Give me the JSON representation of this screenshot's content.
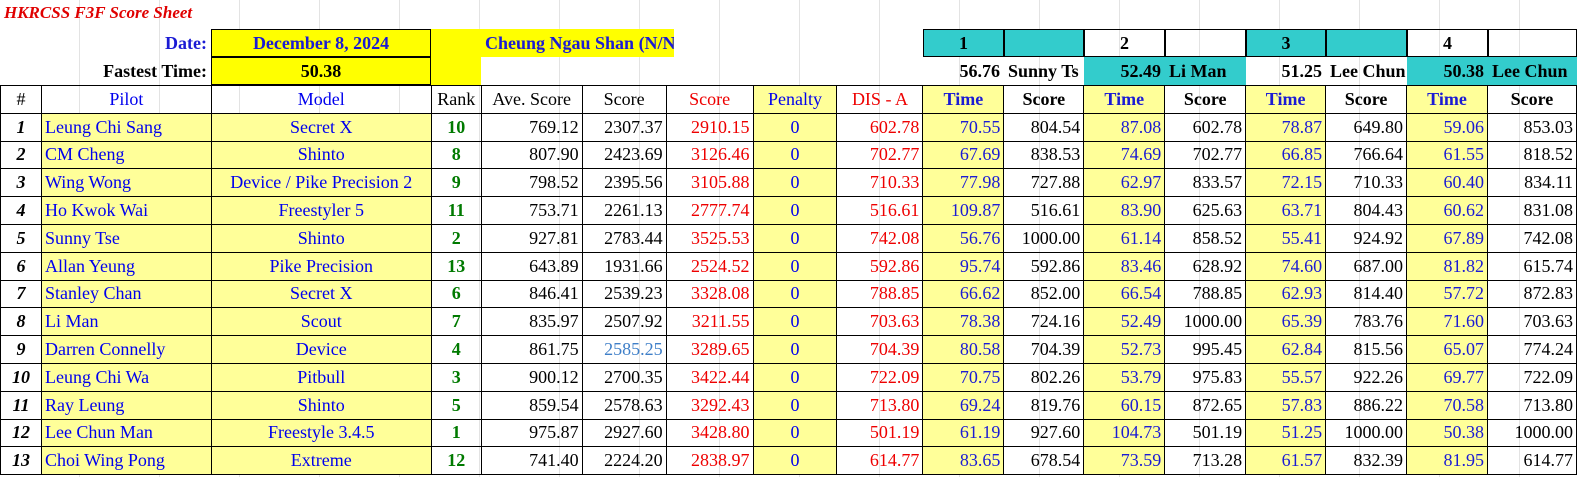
{
  "sheet": {
    "title": "HKRCSS F3F Score Sheet",
    "date_label": "Date:",
    "date_value": "December 8, 2024",
    "fastest_label": "Fastest Time:",
    "fastest_value": "50.38",
    "location": "Cheung Ngau Shan (N/NE)"
  },
  "rounds": [
    {
      "number": "1",
      "best_time": "56.76",
      "best_pilot": "Sunny Ts"
    },
    {
      "number": "2",
      "best_time": "52.49",
      "best_pilot": "Li Man"
    },
    {
      "number": "3",
      "best_time": "51.25",
      "best_pilot": "Lee Chun"
    },
    {
      "number": "4",
      "best_time": "50.38",
      "best_pilot": "Lee Chun"
    }
  ],
  "columns": {
    "index": "#",
    "pilot": "Pilot",
    "model": "Model",
    "rank": "Rank",
    "ave_score": "Ave. Score",
    "score": "Score",
    "score_total": "Score",
    "penalty": "Penalty",
    "dis": "DIS - A",
    "time": "Time",
    "round_score": "Score"
  },
  "rows": [
    {
      "idx": "1",
      "pilot": "Leung Chi Sang",
      "model": "Secret X",
      "rank": "10",
      "ave": "769.12",
      "score": "2307.37",
      "total": "2910.15",
      "penalty": "0",
      "dis": "602.78",
      "r": [
        [
          "70.55",
          "804.54"
        ],
        [
          "87.08",
          "602.78"
        ],
        [
          "78.87",
          "649.80"
        ],
        [
          "59.06",
          "853.03"
        ]
      ]
    },
    {
      "idx": "2",
      "pilot": "CM Cheng",
      "model": "Shinto",
      "rank": "8",
      "ave": "807.90",
      "score": "2423.69",
      "total": "3126.46",
      "penalty": "0",
      "dis": "702.77",
      "r": [
        [
          "67.69",
          "838.53"
        ],
        [
          "74.69",
          "702.77"
        ],
        [
          "66.85",
          "766.64"
        ],
        [
          "61.55",
          "818.52"
        ]
      ]
    },
    {
      "idx": "3",
      "pilot": "Wing Wong",
      "model": "Device / Pike Precision 2",
      "rank": "9",
      "ave": "798.52",
      "score": "2395.56",
      "total": "3105.88",
      "penalty": "0",
      "dis": "710.33",
      "r": [
        [
          "77.98",
          "727.88"
        ],
        [
          "62.97",
          "833.57"
        ],
        [
          "72.15",
          "710.33"
        ],
        [
          "60.40",
          "834.11"
        ]
      ]
    },
    {
      "idx": "4",
      "pilot": "Ho Kwok Wai",
      "model": "Freestyler 5",
      "rank": "11",
      "ave": "753.71",
      "score": "2261.13",
      "total": "2777.74",
      "penalty": "0",
      "dis": "516.61",
      "r": [
        [
          "109.87",
          "516.61"
        ],
        [
          "83.90",
          "625.63"
        ],
        [
          "63.71",
          "804.43"
        ],
        [
          "60.62",
          "831.08"
        ]
      ]
    },
    {
      "idx": "5",
      "pilot": "Sunny Tse",
      "model": "Shinto",
      "rank": "2",
      "ave": "927.81",
      "score": "2783.44",
      "total": "3525.53",
      "penalty": "0",
      "dis": "742.08",
      "r": [
        [
          "56.76",
          "1000.00"
        ],
        [
          "61.14",
          "858.52"
        ],
        [
          "55.41",
          "924.92"
        ],
        [
          "67.89",
          "742.08"
        ]
      ]
    },
    {
      "idx": "6",
      "pilot": "Allan Yeung",
      "model": "Pike Precision",
      "rank": "13",
      "ave": "643.89",
      "score": "1931.66",
      "total": "2524.52",
      "penalty": "0",
      "dis": "592.86",
      "r": [
        [
          "95.74",
          "592.86"
        ],
        [
          "83.46",
          "628.92"
        ],
        [
          "74.60",
          "687.00"
        ],
        [
          "81.82",
          "615.74"
        ]
      ]
    },
    {
      "idx": "7",
      "pilot": "Stanley Chan",
      "model": "Secret X",
      "rank": "6",
      "ave": "846.41",
      "score": "2539.23",
      "total": "3328.08",
      "penalty": "0",
      "dis": "788.85",
      "r": [
        [
          "66.62",
          "852.00"
        ],
        [
          "66.54",
          "788.85"
        ],
        [
          "62.93",
          "814.40"
        ],
        [
          "57.72",
          "872.83"
        ]
      ]
    },
    {
      "idx": "8",
      "pilot": "Li Man",
      "model": "Scout",
      "rank": "7",
      "ave": "835.97",
      "score": "2507.92",
      "total": "3211.55",
      "penalty": "0",
      "dis": "703.63",
      "r": [
        [
          "78.38",
          "724.16"
        ],
        [
          "52.49",
          "1000.00"
        ],
        [
          "65.39",
          "783.76"
        ],
        [
          "71.60",
          "703.63"
        ]
      ]
    },
    {
      "idx": "9",
      "pilot": "Darren Connelly",
      "model": "Device",
      "rank": "4",
      "ave": "861.75",
      "score": "2585.25",
      "total": "3289.65",
      "penalty": "0",
      "dis": "704.39",
      "r": [
        [
          "80.58",
          "704.39"
        ],
        [
          "52.73",
          "995.45"
        ],
        [
          "62.84",
          "815.56"
        ],
        [
          "65.07",
          "774.24"
        ]
      ]
    },
    {
      "idx": "10",
      "pilot": "Leung Chi Wa",
      "model": "Pitbull",
      "rank": "3",
      "ave": "900.12",
      "score": "2700.35",
      "total": "3422.44",
      "penalty": "0",
      "dis": "722.09",
      "r": [
        [
          "70.75",
          "802.26"
        ],
        [
          "53.79",
          "975.83"
        ],
        [
          "55.57",
          "922.26"
        ],
        [
          "69.77",
          "722.09"
        ]
      ]
    },
    {
      "idx": "11",
      "pilot": "Ray Leung",
      "model": "Shinto",
      "rank": "5",
      "ave": "859.54",
      "score": "2578.63",
      "total": "3292.43",
      "penalty": "0",
      "dis": "713.80",
      "r": [
        [
          "69.24",
          "819.76"
        ],
        [
          "60.15",
          "872.65"
        ],
        [
          "57.83",
          "886.22"
        ],
        [
          "70.58",
          "713.80"
        ]
      ]
    },
    {
      "idx": "12",
      "pilot": "Lee Chun Man",
      "model": "Freestyle 3.4.5",
      "rank": "1",
      "ave": "975.87",
      "score": "2927.60",
      "total": "3428.80",
      "penalty": "0",
      "dis": "501.19",
      "r": [
        [
          "61.19",
          "927.60"
        ],
        [
          "104.73",
          "501.19"
        ],
        [
          "51.25",
          "1000.00"
        ],
        [
          "50.38",
          "1000.00"
        ]
      ]
    },
    {
      "idx": "13",
      "pilot": "Choi Wing Pong",
      "model": "Extreme",
      "rank": "12",
      "ave": "741.40",
      "score": "2224.20",
      "total": "2838.97",
      "penalty": "0",
      "dis": "614.77",
      "r": [
        [
          "83.65",
          "678.54"
        ],
        [
          "73.59",
          "713.28"
        ],
        [
          "61.57",
          "832.39"
        ],
        [
          "81.95",
          "614.77"
        ]
      ]
    }
  ]
}
